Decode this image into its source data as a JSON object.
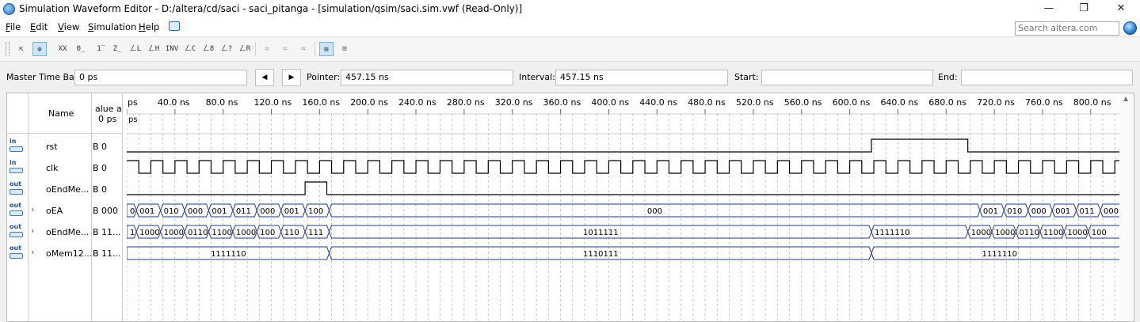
{
  "window": {
    "title": "Simulation Waveform Editor - D:/altera/cd/saci - saci_pitanga - [simulation/qsim/saci.sim.vwf (Read-Only)]",
    "minimize": "—",
    "maximize": "❐",
    "close": "✕"
  },
  "menu": {
    "items": [
      {
        "key": "F",
        "rest": "ile"
      },
      {
        "key": "E",
        "rest": "dit"
      },
      {
        "key": "V",
        "rest": "iew"
      },
      {
        "key": "S",
        "rest": "imulation"
      },
      {
        "key": "H",
        "rest": "elp"
      }
    ],
    "search_placeholder": "Search altera.com"
  },
  "toolbar": {
    "tools": [
      "selection-tool",
      "zoom-tool",
      "unknown-value",
      "forcing-low",
      "forcing-high",
      "high-impedance",
      "weak-low",
      "weak-high",
      "don't-care",
      "invert",
      "count-value",
      "clock",
      "random-values",
      "overwrite-value",
      "dont-care-2",
      "override-tool",
      "snap-to-grid",
      "arrange-tool",
      "grid-settings",
      "bus-display"
    ],
    "labels": [
      "⇱",
      "⊕",
      "XX",
      "0̲",
      "1̅",
      "Z̲",
      "ㄥL",
      "ㄥH",
      "INV",
      "ㄥC",
      "ㄥ8",
      "ㄥ?",
      "ㄥR",
      "⇆",
      "⇆",
      "⇆",
      "⊞",
      "⊡"
    ]
  },
  "timebar": {
    "master_label": "Master Time Bar:",
    "master_value": "0 ps",
    "prev_glyph": "◀",
    "next_glyph": "▶",
    "pointer_label": "Pointer:",
    "pointer_value": "457.15 ns",
    "interval_label": "Interval:",
    "interval_value": "457.15 ns",
    "start_label": "Start:",
    "start_value": "",
    "end_label": "End:",
    "end_value": ""
  },
  "columns": {
    "name": "Name",
    "value_line1": "alue a",
    "value_line2": "0 ps"
  },
  "timeline": {
    "ticks": [
      "0 ps",
      "40.0 ns",
      "80.0 ns",
      "120.0 ns",
      "160.0 ns",
      "200.0 ns",
      "240.0 ns",
      "280.0 ns",
      "320.0 ns",
      "360.0 ns",
      "400.0 ns",
      "440.0 ns",
      "480.0 ns",
      "520.0 ns",
      "560.0 ns",
      "600.0 ns",
      "640.0 ns",
      "680.0 ns",
      "720.0 ns",
      "760.0 ns",
      "800.0 ns"
    ],
    "first_tick_text": "ps",
    "time_bar_label": "ps"
  },
  "signals": [
    {
      "dir": "in",
      "expand": "",
      "name": "rst",
      "value": "B 0"
    },
    {
      "dir": "in",
      "expand": "",
      "name": "clk",
      "value": "B 0"
    },
    {
      "dir": "out",
      "expand": "",
      "name": "oEndMe...",
      "value": "B 0"
    },
    {
      "dir": "out",
      "expand": "›",
      "name": "oEA",
      "value": "B 000"
    },
    {
      "dir": "out",
      "expand": "›",
      "name": "oEndMe...",
      "value": "B 11..."
    },
    {
      "dir": "out",
      "expand": "›",
      "name": "oMem12...",
      "value": "B 11..."
    }
  ],
  "waves": {
    "oEA_segments": [
      "0",
      "001",
      "010",
      "000",
      "001",
      "011",
      "000",
      "001",
      "100",
      "000",
      "001",
      "010",
      "000",
      "001",
      "011",
      "000"
    ],
    "oEndMem_segments": [
      "1",
      "1000",
      "1000",
      "0110",
      "1100",
      "1000",
      "100",
      "110",
      "111",
      "1011111",
      "1111110",
      "1000",
      "1000",
      "0110",
      "1100",
      "1000",
      "100"
    ],
    "oMem_segments": [
      "1111110",
      "1110111",
      "1111110"
    ]
  },
  "colors": {
    "wave": "#000000",
    "bus": "#1f3a8a",
    "grid": "#b8b8b8"
  }
}
